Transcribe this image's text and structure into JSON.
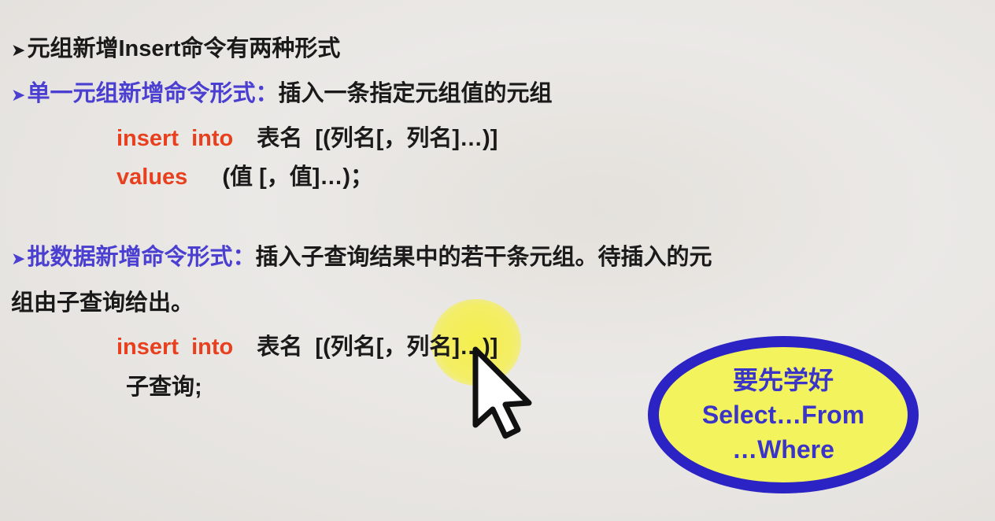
{
  "slide": {
    "heading": "元组新增Insert命令有两种形式",
    "single": {
      "label": "单一元组新增命令形式：",
      "desc": "插入一条指定元组值的元组",
      "kw_insert_into": "insert  into",
      "table_part": "表名  [(列名[，列名]…)]",
      "kw_values": "values",
      "values_part": "(值 [，值]…)；"
    },
    "batch": {
      "label": "批数据新增命令形式：",
      "desc": "插入子查询结果中的若干条元组。待插入的元",
      "desc_cont": "组由子查询给出。",
      "kw_insert_into": "insert  into",
      "table_part": "表名  [(列名[，列名]…)]",
      "subquery": "子查询;"
    },
    "callout": {
      "line1": "要先学好",
      "line2": "Select…From",
      "line3": "…Where"
    }
  },
  "colors": {
    "blue": "#4a3fd0",
    "red": "#e8401e",
    "callout_border": "#2b23c4",
    "callout_fill": "#f3f35e"
  }
}
